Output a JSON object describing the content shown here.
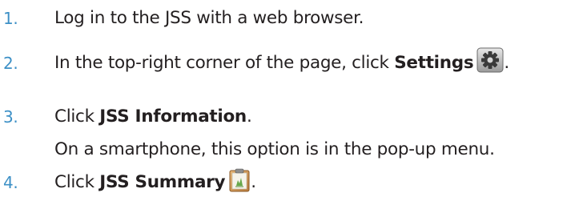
{
  "steps": [
    {
      "number": "1.",
      "text": "Log in to the JSS with a web browser."
    },
    {
      "number": "2.",
      "before": "In the top-right corner of the page, click ",
      "bold": "Settings",
      "icon": "gear-icon",
      "after": "."
    },
    {
      "number": "3.",
      "before": "Click ",
      "bold": "JSS Information",
      "after": ".",
      "note": "On a smartphone, this option is in the pop-up menu."
    },
    {
      "number": "4.",
      "before": "Click ",
      "bold": "JSS Summary",
      "icon": "clipboard-icon",
      "after": "."
    }
  ],
  "colors": {
    "number": "#3d90c6",
    "text": "#231f20"
  }
}
